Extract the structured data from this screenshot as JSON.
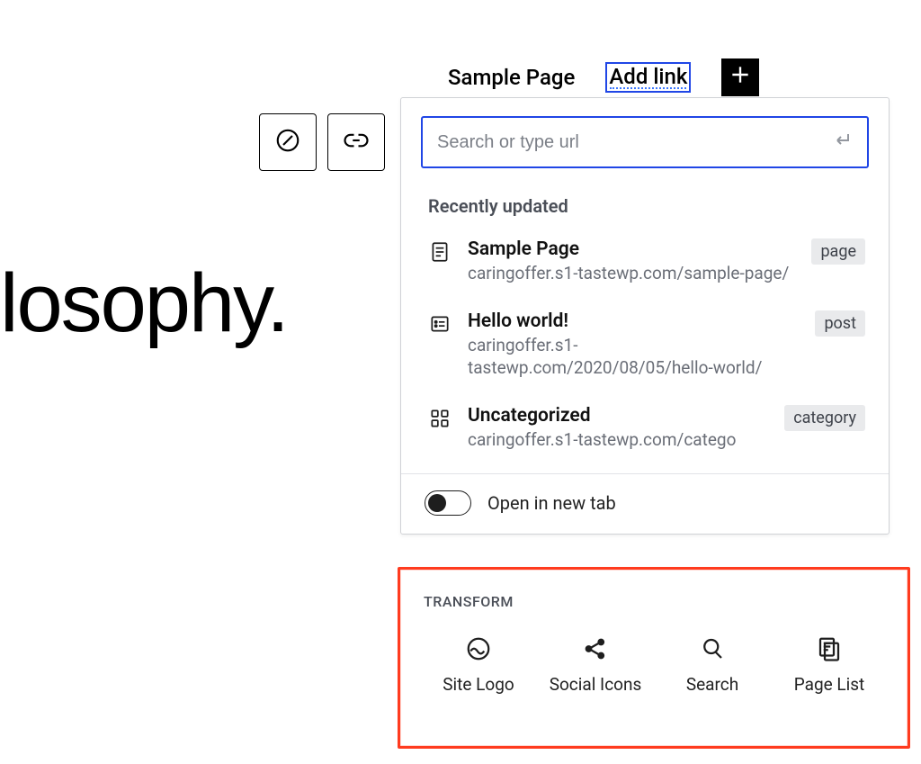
{
  "background": {
    "heading_fragment": "losophy."
  },
  "nav": {
    "item1": "Sample Page",
    "item2": "Add link"
  },
  "toolbar_icons": {
    "explore": "compass-icon",
    "link": "link-icon"
  },
  "popover": {
    "search_placeholder": "Search or type url",
    "recently_label": "Recently updated",
    "results": [
      {
        "title": "Sample Page",
        "url": "caringoffer.s1-tastewp.com/sample-page/",
        "type": "page",
        "icon": "page-icon"
      },
      {
        "title": "Hello world!",
        "url": "caringoffer.s1-tastewp.com/2020/08/05/hello-world/",
        "type": "post",
        "icon": "post-icon"
      },
      {
        "title": "Uncategorized",
        "url": "caringoffer.s1-tastewp.com/catego",
        "type": "category",
        "icon": "category-icon"
      }
    ],
    "open_new_tab_label": "Open in new tab"
  },
  "transform": {
    "heading": "TRANSFORM",
    "items": [
      {
        "label": "Site Logo",
        "icon": "site-logo-icon"
      },
      {
        "label": "Social Icons",
        "icon": "share-icon"
      },
      {
        "label": "Search",
        "icon": "search-icon"
      },
      {
        "label": "Page List",
        "icon": "page-list-icon"
      }
    ]
  },
  "colors": {
    "accent": "#2046e6",
    "highlight_border": "#ff3b1f"
  }
}
